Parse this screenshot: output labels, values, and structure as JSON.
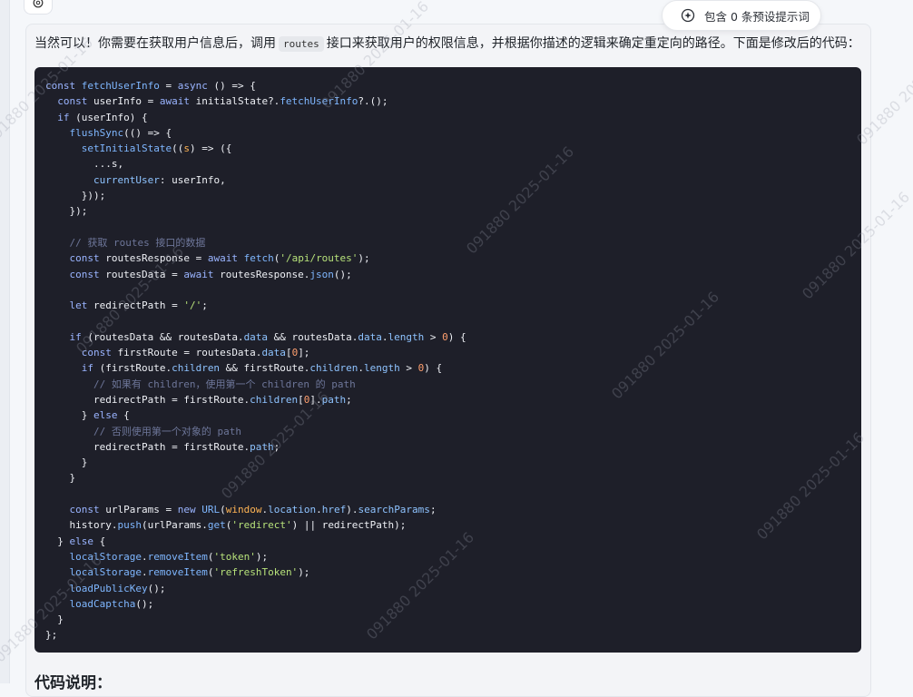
{
  "header": {
    "preset_pill_label": "包含 0 条预设提示词",
    "preset_pill_icon": "sparkle-shield-icon"
  },
  "message": {
    "intro_before": "当然可以！你需要在获取用户信息后，调用",
    "intro_code": "routes",
    "intro_after": "接口来获取用户的权限信息，并根据你描述的逻辑来确定重定向的路径。下面是修改后的代码：",
    "next_heading": "代码说明："
  },
  "code": {
    "language": "javascript",
    "lines": [
      [
        [
          "kw",
          "const "
        ],
        [
          "fn",
          "fetchUserInfo"
        ],
        [
          "pl",
          " = "
        ],
        [
          "kw",
          "async"
        ],
        [
          "pl",
          " () => {"
        ]
      ],
      [
        [
          "kw",
          "  const "
        ],
        [
          "pl",
          "userInfo = "
        ],
        [
          "kw",
          "await "
        ],
        [
          "pl",
          "initialState?."
        ],
        [
          "fn",
          "fetchUserInfo"
        ],
        [
          "pl",
          "?.();"
        ]
      ],
      [
        [
          "kw",
          "  if"
        ],
        [
          "pl",
          " (userInfo) {"
        ]
      ],
      [
        [
          "pl",
          "    "
        ],
        [
          "fn",
          "flushSync"
        ],
        [
          "pl",
          "(() => {"
        ]
      ],
      [
        [
          "pl",
          "      "
        ],
        [
          "fn",
          "setInitialState"
        ],
        [
          "pl",
          "(("
        ],
        [
          "pm",
          "s"
        ],
        [
          "pl",
          ") => ({"
        ]
      ],
      [
        [
          "pl",
          "        ...s,"
        ]
      ],
      [
        [
          "pl",
          "        "
        ],
        [
          "prop",
          "currentUser"
        ],
        [
          "pl",
          ": userInfo,"
        ]
      ],
      [
        [
          "pl",
          "      }));"
        ]
      ],
      [
        [
          "pl",
          "    });"
        ]
      ],
      [
        [
          "pl",
          ""
        ]
      ],
      [
        [
          "cm",
          "    // 获取 routes 接口的数据"
        ]
      ],
      [
        [
          "kw",
          "    const "
        ],
        [
          "pl",
          "routesResponse = "
        ],
        [
          "kw",
          "await "
        ],
        [
          "fn",
          "fetch"
        ],
        [
          "pl",
          "("
        ],
        [
          "str",
          "'/api/routes'"
        ],
        [
          "pl",
          ");"
        ]
      ],
      [
        [
          "kw",
          "    const "
        ],
        [
          "pl",
          "routesData = "
        ],
        [
          "kw",
          "await "
        ],
        [
          "pl",
          "routesResponse."
        ],
        [
          "fn",
          "json"
        ],
        [
          "pl",
          "();"
        ]
      ],
      [
        [
          "pl",
          ""
        ]
      ],
      [
        [
          "kw",
          "    let "
        ],
        [
          "pl",
          "redirectPath = "
        ],
        [
          "str",
          "'/'"
        ],
        [
          "pl",
          ";"
        ]
      ],
      [
        [
          "pl",
          ""
        ]
      ],
      [
        [
          "kw",
          "    if"
        ],
        [
          "pl",
          " (routesData && routesData."
        ],
        [
          "prop",
          "data"
        ],
        [
          "pl",
          " && routesData."
        ],
        [
          "prop",
          "data"
        ],
        [
          "pl",
          "."
        ],
        [
          "prop",
          "length"
        ],
        [
          "pl",
          " > "
        ],
        [
          "num",
          "0"
        ],
        [
          "pl",
          ") {"
        ]
      ],
      [
        [
          "kw",
          "      const "
        ],
        [
          "pl",
          "firstRoute = routesData."
        ],
        [
          "prop",
          "data"
        ],
        [
          "pl",
          "["
        ],
        [
          "num",
          "0"
        ],
        [
          "pl",
          "];"
        ]
      ],
      [
        [
          "kw",
          "      if"
        ],
        [
          "pl",
          " (firstRoute."
        ],
        [
          "prop",
          "children"
        ],
        [
          "pl",
          " && firstRoute."
        ],
        [
          "prop",
          "children"
        ],
        [
          "pl",
          "."
        ],
        [
          "prop",
          "length"
        ],
        [
          "pl",
          " > "
        ],
        [
          "num",
          "0"
        ],
        [
          "pl",
          ") {"
        ]
      ],
      [
        [
          "cm",
          "        // 如果有 children，使用第一个 children 的 path"
        ]
      ],
      [
        [
          "pl",
          "        redirectPath = firstRoute."
        ],
        [
          "prop",
          "children"
        ],
        [
          "pl",
          "["
        ],
        [
          "num",
          "0"
        ],
        [
          "pl",
          "]."
        ],
        [
          "prop",
          "path"
        ],
        [
          "pl",
          ";"
        ]
      ],
      [
        [
          "pl",
          "      } "
        ],
        [
          "kw",
          "else"
        ],
        [
          "pl",
          " {"
        ]
      ],
      [
        [
          "cm",
          "        // 否则使用第一个对象的 path"
        ]
      ],
      [
        [
          "pl",
          "        redirectPath = firstRoute."
        ],
        [
          "prop",
          "path"
        ],
        [
          "pl",
          ";"
        ]
      ],
      [
        [
          "pl",
          "      }"
        ]
      ],
      [
        [
          "pl",
          "    }"
        ]
      ],
      [
        [
          "pl",
          ""
        ]
      ],
      [
        [
          "kw",
          "    const "
        ],
        [
          "pl",
          "urlParams = "
        ],
        [
          "kw",
          "new "
        ],
        [
          "fn",
          "URL"
        ],
        [
          "pl",
          "("
        ],
        [
          "pm",
          "window"
        ],
        [
          "pl",
          "."
        ],
        [
          "prop",
          "location"
        ],
        [
          "pl",
          "."
        ],
        [
          "prop",
          "href"
        ],
        [
          "pl",
          ")."
        ],
        [
          "prop",
          "searchParams"
        ],
        [
          "pl",
          ";"
        ]
      ],
      [
        [
          "pl",
          "    history."
        ],
        [
          "fn",
          "push"
        ],
        [
          "pl",
          "(urlParams."
        ],
        [
          "fn",
          "get"
        ],
        [
          "pl",
          "("
        ],
        [
          "str",
          "'redirect'"
        ],
        [
          "pl",
          ") || redirectPath);"
        ]
      ],
      [
        [
          "pl",
          "  } "
        ],
        [
          "kw",
          "else"
        ],
        [
          "pl",
          " {"
        ]
      ],
      [
        [
          "pl",
          "    "
        ],
        [
          "fn",
          "localStorage"
        ],
        [
          "pl",
          "."
        ],
        [
          "fn",
          "removeItem"
        ],
        [
          "pl",
          "("
        ],
        [
          "str",
          "'token'"
        ],
        [
          "pl",
          ");"
        ]
      ],
      [
        [
          "pl",
          "    "
        ],
        [
          "fn",
          "localStorage"
        ],
        [
          "pl",
          "."
        ],
        [
          "fn",
          "removeItem"
        ],
        [
          "pl",
          "("
        ],
        [
          "str",
          "'refreshToken'"
        ],
        [
          "pl",
          ");"
        ]
      ],
      [
        [
          "pl",
          "    "
        ],
        [
          "fn",
          "loadPublicKey"
        ],
        [
          "pl",
          "();"
        ]
      ],
      [
        [
          "pl",
          "    "
        ],
        [
          "fn",
          "loadCaptcha"
        ],
        [
          "pl",
          "();"
        ]
      ],
      [
        [
          "pl",
          "  }"
        ]
      ],
      [
        [
          "pl",
          "};"
        ]
      ]
    ]
  },
  "watermark": {
    "text": "091880  2025-01-16"
  },
  "colors": {
    "code_bg": "#1e1f29",
    "page_bg": "#f5f7fa",
    "bubble_bg": "#f3f4f7"
  }
}
